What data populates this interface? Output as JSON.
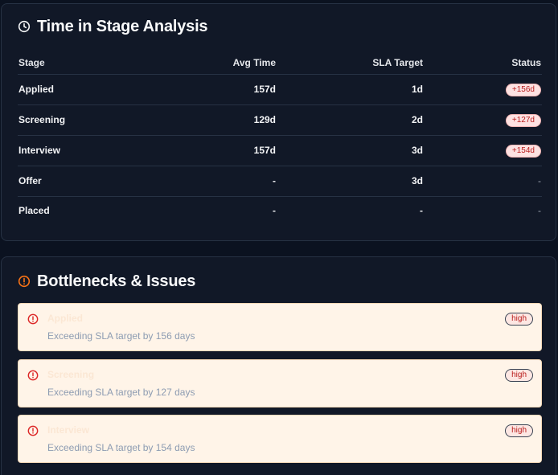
{
  "stage_card": {
    "title": "Time in Stage Analysis",
    "icon": "clock-icon",
    "columns": {
      "stage": "Stage",
      "avg_time": "Avg Time",
      "sla_target": "SLA Target",
      "status": "Status"
    },
    "rows": [
      {
        "stage": "Applied",
        "avg_time": "157d",
        "sla_target": "1d",
        "status": "+156d"
      },
      {
        "stage": "Screening",
        "avg_time": "129d",
        "sla_target": "2d",
        "status": "+127d"
      },
      {
        "stage": "Interview",
        "avg_time": "157d",
        "sla_target": "3d",
        "status": "+154d"
      },
      {
        "stage": "Offer",
        "avg_time": "-",
        "sla_target": "3d",
        "status": "-"
      },
      {
        "stage": "Placed",
        "avg_time": "-",
        "sla_target": "-",
        "status": "-"
      }
    ]
  },
  "issues_card": {
    "title": "Bottlenecks & Issues",
    "icon": "alert-circle-icon",
    "accent_color": "#f97316",
    "items": [
      {
        "title": "Applied",
        "description": "Exceeding SLA target by 156 days",
        "severity": "high"
      },
      {
        "title": "Screening",
        "description": "Exceeding SLA target by 127 days",
        "severity": "high"
      },
      {
        "title": "Interview",
        "description": "Exceeding SLA target by 154 days",
        "severity": "high"
      }
    ]
  }
}
